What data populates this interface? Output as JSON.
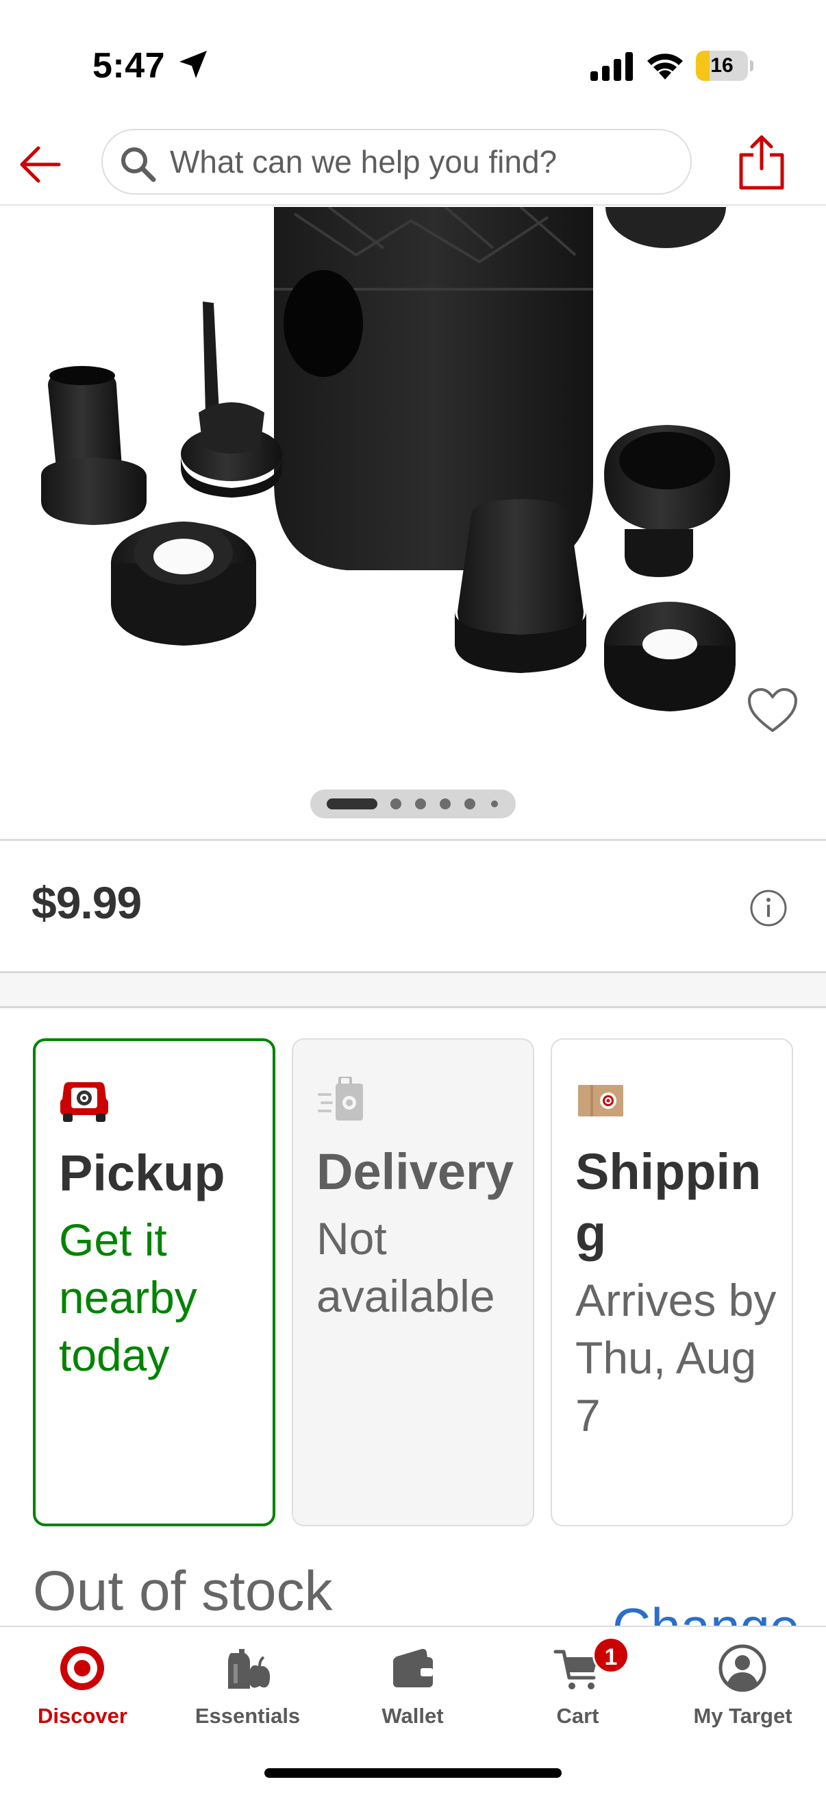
{
  "status_bar": {
    "time": "5:47",
    "battery_level": "16",
    "battery_percent": 16
  },
  "header": {
    "search_placeholder": "What can we help you find?"
  },
  "product": {
    "carousel_total": 6,
    "carousel_active": 1,
    "price": "$9.99"
  },
  "fulfillment": {
    "pickup": {
      "title": "Pickup",
      "subtitle": "Get it nearby today"
    },
    "delivery": {
      "title": "Delivery",
      "subtitle": "Not available"
    },
    "shipping": {
      "title": "Shipping",
      "subtitle": "Arrives by Thu, Aug 7"
    }
  },
  "stock": {
    "status": "Out of stock",
    "change_label": "Change"
  },
  "tabs": [
    {
      "label": "Discover",
      "icon": "bullseye-icon"
    },
    {
      "label": "Essentials",
      "icon": "essentials-icon"
    },
    {
      "label": "Wallet",
      "icon": "wallet-icon"
    },
    {
      "label": "Cart",
      "icon": "cart-icon",
      "badge": "1"
    },
    {
      "label": "My Target",
      "icon": "account-icon"
    }
  ],
  "colors": {
    "brand_red": "#cc0000",
    "pickup_green": "#008300",
    "link_blue": "#2a6fc9"
  }
}
